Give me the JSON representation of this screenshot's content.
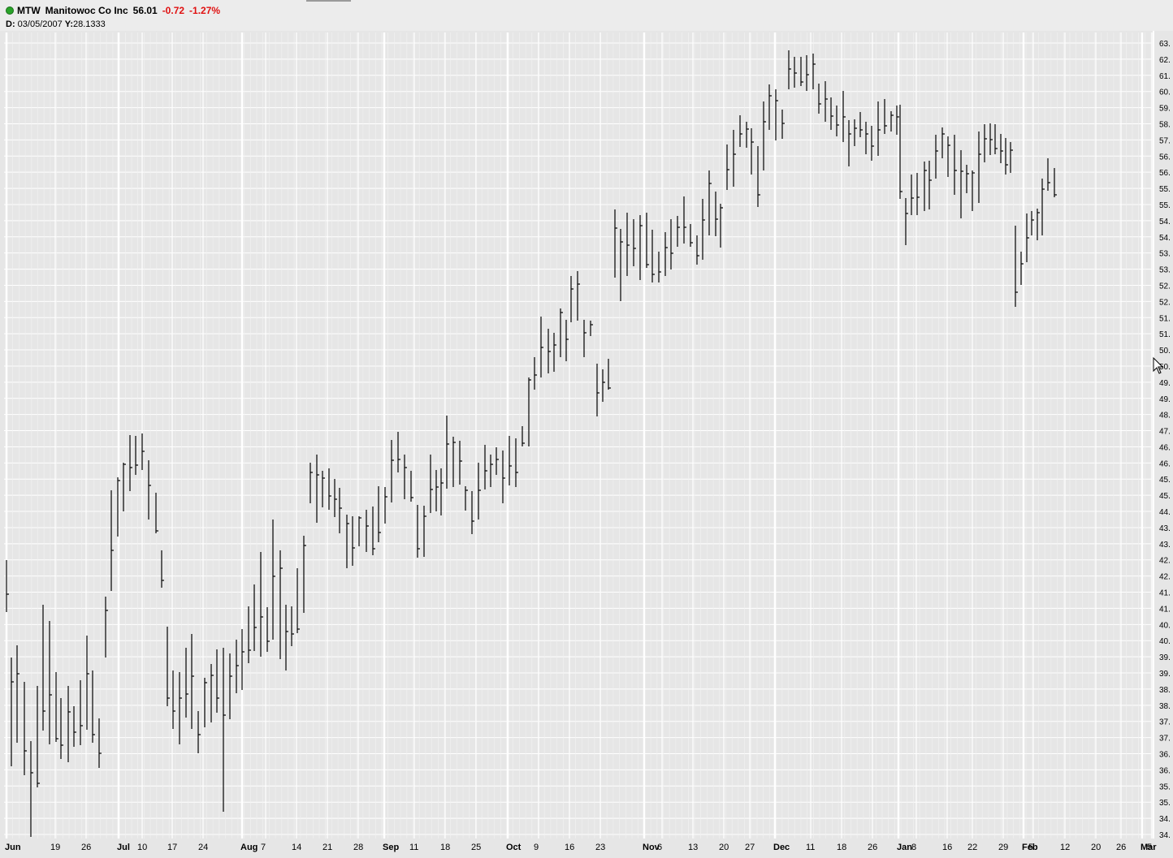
{
  "header": {
    "symbol": "MTW",
    "name": "Manitowoc Co Inc",
    "last": "56.01",
    "change": "-0.72",
    "change_pct": "-1.27%",
    "change_color": "#e01010",
    "cursor_date_label": "D:",
    "cursor_date": "03/05/2007",
    "cursor_y_label": "Y:",
    "cursor_y": "28.1333",
    "status_icon": "green-circle-icon"
  },
  "chart_data": {
    "type": "ohlc",
    "title": "MTW Manitowoc Co Inc",
    "ylim": [
      34.0,
      63.3
    ],
    "y_tick_labels": [
      "63.",
      "62.",
      "61.",
      "60.",
      "59.",
      "58.",
      "57.",
      "56.",
      "56.",
      "55.",
      "55.",
      "54.",
      "54.",
      "53.",
      "53.",
      "52.",
      "52.",
      "51.",
      "51.",
      "50.",
      "50.",
      "49.",
      "49.",
      "48.",
      "47.",
      "46.",
      "46.",
      "45.",
      "45.",
      "44.",
      "43.",
      "43.",
      "42.",
      "42.",
      "41.",
      "41.",
      "40.",
      "40.",
      "39.",
      "39.",
      "38.",
      "38.",
      "37.",
      "37.",
      "36.",
      "36.",
      "35.",
      "35.",
      "34.",
      "34."
    ],
    "y_tick_values": [
      63.0,
      62.4,
      61.8,
      61.2,
      60.6,
      60.0,
      59.4,
      58.8,
      58.2,
      57.6,
      57.0,
      56.4,
      55.8,
      55.2,
      54.6,
      54.0,
      53.4,
      52.8,
      52.2,
      51.6,
      51.0,
      50.4,
      49.8,
      49.2,
      48.6,
      48.0,
      47.4,
      46.8,
      46.2,
      45.6,
      45.0,
      44.4,
      43.8,
      43.2,
      42.6,
      42.0,
      41.4,
      40.8,
      40.2,
      39.6,
      39.0,
      38.4,
      37.8,
      37.2,
      36.6,
      36.0,
      35.4,
      34.8,
      34.4,
      34.1
    ],
    "x_tick_labels": [
      {
        "label": "Jun",
        "month": true
      },
      {
        "label": "19",
        "month": false
      },
      {
        "label": "26",
        "month": false
      },
      {
        "label": "Jul",
        "month": true
      },
      {
        "label": "10",
        "month": false
      },
      {
        "label": "17",
        "month": false
      },
      {
        "label": "24",
        "month": false
      },
      {
        "label": "Aug",
        "month": true
      },
      {
        "label": "7",
        "month": false
      },
      {
        "label": "14",
        "month": false
      },
      {
        "label": "21",
        "month": false
      },
      {
        "label": "28",
        "month": false
      },
      {
        "label": "Sep",
        "month": true
      },
      {
        "label": "11",
        "month": false
      },
      {
        "label": "18",
        "month": false
      },
      {
        "label": "25",
        "month": false
      },
      {
        "label": "Oct",
        "month": true
      },
      {
        "label": "9",
        "month": false
      },
      {
        "label": "16",
        "month": false
      },
      {
        "label": "23",
        "month": false
      },
      {
        "label": "Nov",
        "month": true
      },
      {
        "label": "6",
        "month": false
      },
      {
        "label": "13",
        "month": false
      },
      {
        "label": "20",
        "month": false
      },
      {
        "label": "27",
        "month": false
      },
      {
        "label": "Dec",
        "month": true
      },
      {
        "label": "11",
        "month": false
      },
      {
        "label": "18",
        "month": false
      },
      {
        "label": "26",
        "month": false
      },
      {
        "label": "Jan",
        "month": true
      },
      {
        "label": "8",
        "month": false
      },
      {
        "label": "16",
        "month": false
      },
      {
        "label": "22",
        "month": false
      },
      {
        "label": "29",
        "month": false
      },
      {
        "label": "Feb",
        "month": true
      },
      {
        "label": "5",
        "month": false
      },
      {
        "label": "12",
        "month": false
      },
      {
        "label": "20",
        "month": false
      },
      {
        "label": "26",
        "month": false
      },
      {
        "label": "Mar",
        "month": true
      },
      {
        "label": "5",
        "month": false
      }
    ],
    "grid": true,
    "colors": {
      "background": "#e6e6e6",
      "grid": "#ffffff",
      "bars": "#000000"
    }
  }
}
